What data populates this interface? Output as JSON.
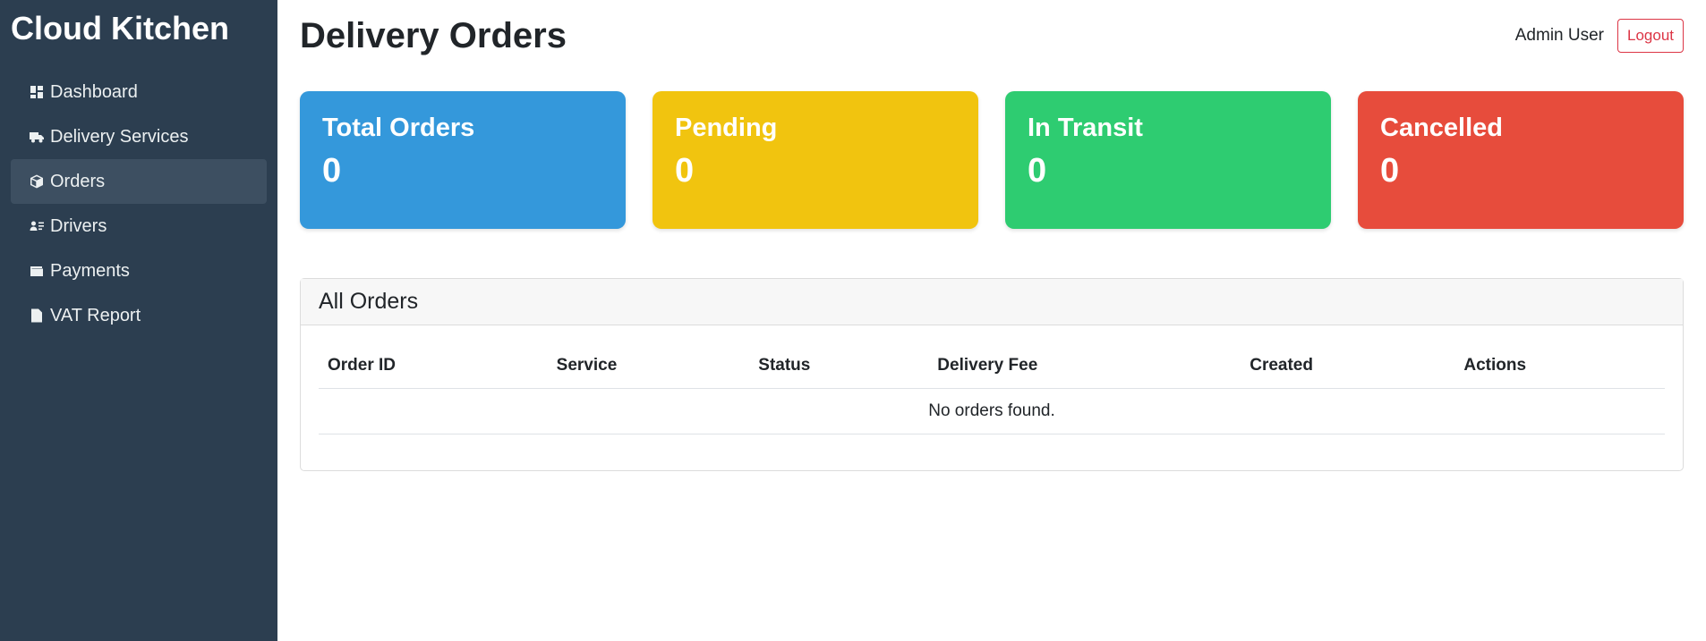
{
  "sidebar": {
    "brand": "Cloud Kitchen",
    "items": [
      {
        "label": "Dashboard",
        "icon": "dashboard-icon",
        "active": false
      },
      {
        "label": "Delivery Services",
        "icon": "truck-icon",
        "active": false
      },
      {
        "label": "Orders",
        "icon": "box-icon",
        "active": true
      },
      {
        "label": "Drivers",
        "icon": "driver-card-icon",
        "active": false
      },
      {
        "label": "Payments",
        "icon": "wallet-icon",
        "active": false
      },
      {
        "label": "VAT Report",
        "icon": "document-icon",
        "active": false
      }
    ]
  },
  "header": {
    "title": "Delivery Orders",
    "user_name": "Admin User",
    "logout_label": "Logout"
  },
  "stats": [
    {
      "label": "Total Orders",
      "value": "0",
      "color": "#3498db"
    },
    {
      "label": "Pending",
      "value": "0",
      "color": "#f1c40f"
    },
    {
      "label": "In Transit",
      "value": "0",
      "color": "#2ecc71"
    },
    {
      "label": "Cancelled",
      "value": "0",
      "color": "#e74c3c"
    }
  ],
  "orders_panel": {
    "title": "All Orders",
    "columns": [
      "Order ID",
      "Service",
      "Status",
      "Delivery Fee",
      "Created",
      "Actions"
    ],
    "empty_message": "No orders found."
  },
  "colors": {
    "sidebar_bg": "#2c3e50",
    "active_item_bg": "#3d4f61",
    "danger": "#dc3545"
  }
}
